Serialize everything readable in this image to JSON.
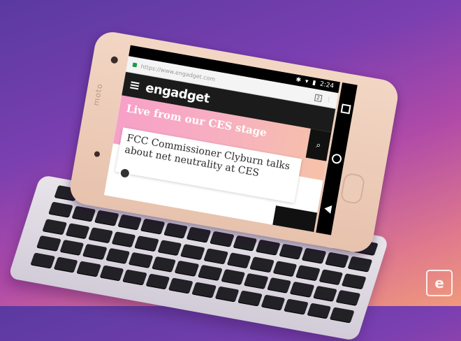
{
  "status_bar": {
    "time": "2:24"
  },
  "browser": {
    "url": "https://www.engadget.com",
    "tab_count": "2",
    "menu_glyph": "⋮"
  },
  "site": {
    "logo": "engadget"
  },
  "hero": {
    "text": "Live from our CES stage"
  },
  "article": {
    "title": "FCC Commissioner Clyburn talks about net neutrality at CES"
  },
  "device": {
    "brand": "moto"
  },
  "watermark": {
    "brand": "engadget",
    "glyph": "e"
  },
  "colors": {
    "background": "#7a3fb0",
    "phone_body": "#f2d6c4",
    "site_header": "#1b1b1b",
    "hero_pink": "#f7a0c8",
    "keyboard_led": "#6aa0ff"
  },
  "icons": [
    "lock-icon",
    "hamburger-icon",
    "search-icon",
    "recent-apps-icon",
    "home-icon",
    "back-icon"
  ]
}
